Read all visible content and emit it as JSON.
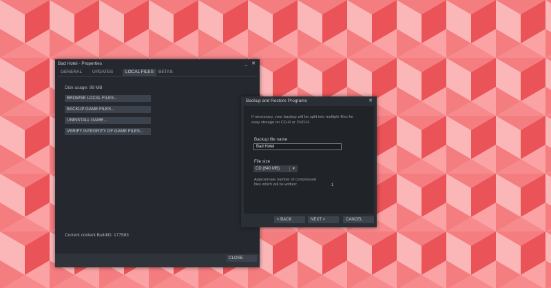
{
  "colors": {
    "bg_light": "#fbb7b8",
    "bg_mid": "#f47d80",
    "bg_dark": "#ea5358",
    "window_bg": "#25292f",
    "button_bg": "#3d434c"
  },
  "properties_window": {
    "title": "Bad Hotel - Properties",
    "minimize_glyph": "_",
    "close_glyph": "✕",
    "tabs": [
      "GENERAL",
      "UPDATES",
      "LOCAL FILES",
      "BETAS"
    ],
    "active_tab": "LOCAL FILES",
    "disk_usage": "Disk usage: 99 MB",
    "buttons": [
      "BROWSE LOCAL FILES...",
      "BACKUP GAME FILES...",
      "UNINSTALL GAME...",
      "VERIFY INTEGRITY OF GAME FILES..."
    ],
    "build_id": "Current content BuildID: 177583",
    "close_label": "CLOSE"
  },
  "backup_window": {
    "title": "Backup and Restore Programs",
    "close_glyph": "✕",
    "info": "If necessary, your backup will be split into multiple files for easy storage on CD-R or DVD-R.",
    "file_name_label": "Backup file name",
    "file_name_value": "Bad Hotel",
    "file_size_label": "File size",
    "file_size_selected": "CD (640 MB)",
    "approx_text": "Approximate number of compressed files which will be written:",
    "approx_count": "1",
    "back_label": "< BACK",
    "next_label": "NEXT >",
    "cancel_label": "CANCEL"
  }
}
